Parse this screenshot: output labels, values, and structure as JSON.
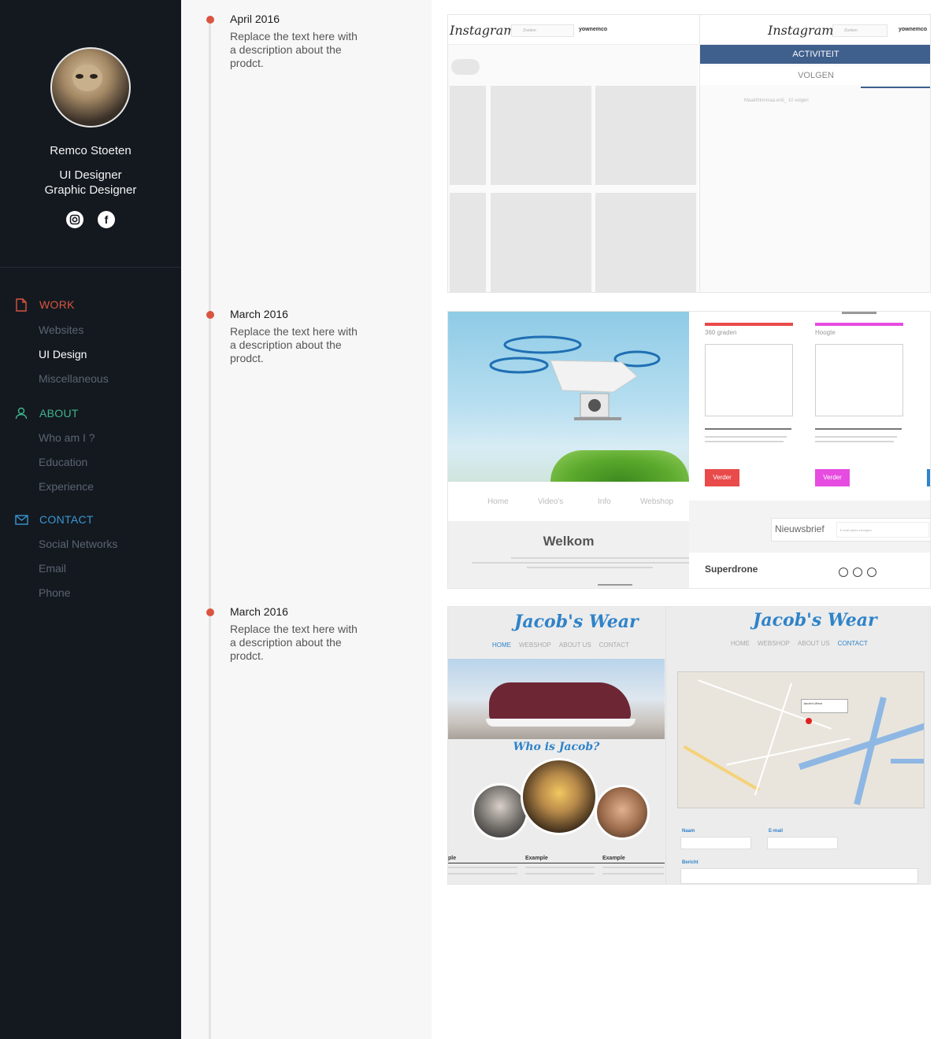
{
  "profile": {
    "name": "Remco Stoeten",
    "roles": [
      "UI Designer",
      "Graphic Designer"
    ],
    "social": [
      {
        "name": "instagram",
        "icon": "instagram-icon",
        "glyph": "◉"
      },
      {
        "name": "facebook",
        "icon": "facebook-icon",
        "glyph": "f"
      }
    ]
  },
  "nav": {
    "sections": [
      {
        "label": "WORK",
        "icon": "file-icon",
        "color": "#d9553f",
        "items": [
          {
            "label": "Websites",
            "active": false
          },
          {
            "label": "UI Design",
            "active": true
          },
          {
            "label": "Miscellaneous",
            "active": false
          }
        ]
      },
      {
        "label": "ABOUT",
        "icon": "user-icon",
        "color": "#3fb58c",
        "items": [
          {
            "label": "Who am I ?",
            "active": false
          },
          {
            "label": "Education",
            "active": false
          },
          {
            "label": "Experience",
            "active": false
          }
        ]
      },
      {
        "label": "CONTACT",
        "icon": "envelope-icon",
        "color": "#3a97d4",
        "items": [
          {
            "label": "Social Networks",
            "active": false
          },
          {
            "label": "Email",
            "active": false
          },
          {
            "label": "Phone",
            "active": false
          }
        ]
      }
    ]
  },
  "timeline": [
    {
      "date": "April 2016",
      "description": "Replace the text here with a description about the prodct."
    },
    {
      "date": "March 2016",
      "description": "Replace the text here with a description about the prodct."
    },
    {
      "date": "March 2016",
      "description": "Replace the text here with a description about the prodct."
    }
  ],
  "projects": {
    "instagram": {
      "logo": "Instagram",
      "search_placeholder": "Zoeken",
      "username": "yownemco",
      "tab_active": "ACTIVITEIT",
      "tab_inactive": "VOLGEN",
      "activity_text": "Maakthkmmaa.enti_ 10 volgen"
    },
    "drone": {
      "nav": [
        "Home",
        "Video's",
        "Info",
        "Webshop"
      ],
      "welcome": "Welkom",
      "cards": [
        {
          "title": "360 graden",
          "button": "Verder",
          "color": "#e94a4a"
        },
        {
          "title": "Hoogte",
          "button": "Verder",
          "color": "#e64ce0"
        }
      ],
      "newsletter_label": "Nieuwsbrief",
      "newsletter_placeholder": "E-mail adres invoegen",
      "brand": "Superdrone"
    },
    "jacobs_wear": {
      "logo": "Jacob's Wear",
      "nav": [
        "HOME",
        "WEBSHOP",
        "ABOUT US",
        "CONTACT"
      ],
      "who": "Who is Jacob?",
      "columns": [
        "ple",
        "Example",
        "Example"
      ],
      "map_popup": "Jacob's Wear",
      "form": {
        "name_label": "Naam",
        "email_label": "E-mail",
        "message_label": "Bericht"
      }
    }
  }
}
